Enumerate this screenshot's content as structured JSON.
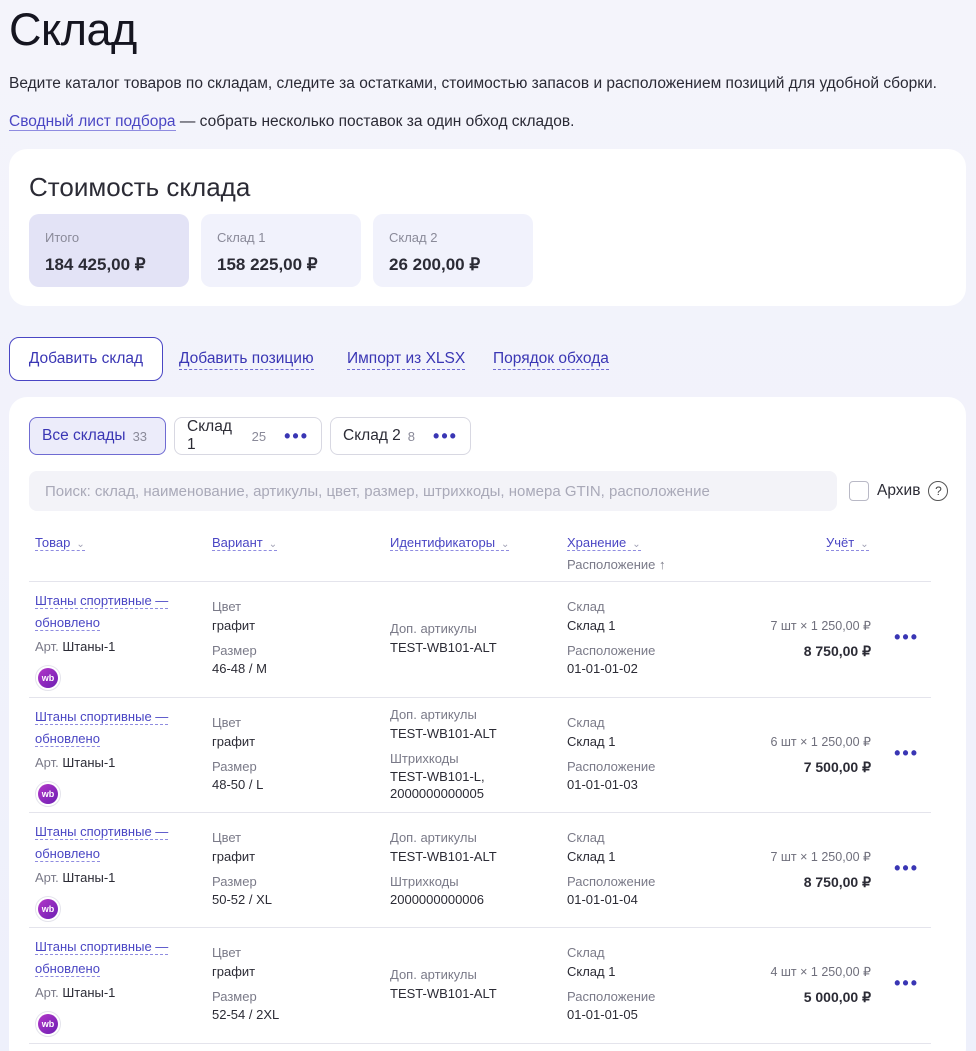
{
  "page": {
    "title": "Склад",
    "intro": "Ведите каталог товаров по складам, следите за остатками, стоимостью запасов и расположением позиций для удобной сборки.",
    "picklist_link": "Сводный лист подбора",
    "picklist_text": " — собрать несколько поставок за один обход складов."
  },
  "value": {
    "title": "Стоимость склада",
    "tiles": [
      {
        "label": "Итого",
        "value": "184 425,00 ₽"
      },
      {
        "label": "Склад 1",
        "value": "158 225,00 ₽"
      },
      {
        "label": "Склад 2",
        "value": "26 200,00 ₽"
      }
    ]
  },
  "actions": {
    "add_warehouse": "Добавить склад",
    "add_position": "Добавить позицию",
    "import": "Импорт из XLSX",
    "route_order": "Порядок обхода"
  },
  "tabs": [
    {
      "label": "Все склады",
      "count": "33"
    },
    {
      "label": "Склад 1",
      "count": "25",
      "menu": "•••"
    },
    {
      "label": "Склад 2",
      "count": "8",
      "menu": "•••"
    }
  ],
  "search": {
    "placeholder": "Поиск: склад, наименование, артикулы, цвет, размер, штрихкоды, номера GTIN, расположение"
  },
  "archive": {
    "label": "Архив",
    "help": "?"
  },
  "columns": {
    "product": "Товар",
    "variant": "Вариант",
    "ids": "Идентификаторы",
    "storage": "Хранение",
    "storage_sub": "Расположение ↑",
    "account": "Учёт"
  },
  "labels": {
    "color": "Цвет",
    "size": "Размер",
    "extra_articles": "Доп. артикулы",
    "barcodes": "Штрихкоды",
    "warehouse": "Склад",
    "location": "Расположение",
    "article_prefix": "Арт.",
    "badge": "wb",
    "menu": "•••"
  },
  "rows": [
    {
      "name_line1": "Штаны спортивные —",
      "name_line2": "обновлено",
      "article": "Штаны-1",
      "color": "графит",
      "size": "46-48 / M",
      "extra_articles": "TEST-WB101-ALT",
      "barcodes": "",
      "warehouse": "Склад 1",
      "location": "01-01-01-02",
      "qty": "7 шт × 1 250,00 ₽",
      "sum": "8 750,00 ₽"
    },
    {
      "name_line1": "Штаны спортивные —",
      "name_line2": "обновлено",
      "article": "Штаны-1",
      "color": "графит",
      "size": "48-50 / L",
      "extra_articles": "TEST-WB101-ALT",
      "barcodes": "TEST-WB101-L,",
      "barcodes2": "2000000000005",
      "warehouse": "Склад 1",
      "location": "01-01-01-03",
      "qty": "6 шт × 1 250,00 ₽",
      "sum": "7 500,00 ₽"
    },
    {
      "name_line1": "Штаны спортивные —",
      "name_line2": "обновлено",
      "article": "Штаны-1",
      "color": "графит",
      "size": "50-52 / XL",
      "extra_articles": "TEST-WB101-ALT",
      "barcodes": "2000000000006",
      "warehouse": "Склад 1",
      "location": "01-01-01-04",
      "qty": "7 шт × 1 250,00 ₽",
      "sum": "8 750,00 ₽"
    },
    {
      "name_line1": "Штаны спортивные —",
      "name_line2": "обновлено",
      "article": "Штаны-1",
      "color": "графит",
      "size": "52-54 / 2XL",
      "extra_articles": "TEST-WB101-ALT",
      "barcodes": "",
      "warehouse": "Склад 1",
      "location": "01-01-01-05",
      "qty": "4 шт × 1 250,00 ₽",
      "sum": "5 000,00 ₽"
    }
  ]
}
